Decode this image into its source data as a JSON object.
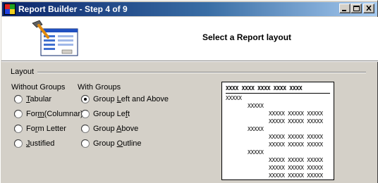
{
  "window": {
    "title": "Report Builder - Step 4 of 9"
  },
  "header": {
    "title": "Select a Report layout"
  },
  "layout_group": {
    "label": "Layout",
    "without_groups": {
      "heading": "Without Groups",
      "options": [
        {
          "label": "Tabular",
          "mnemonic": "T",
          "selected": false
        },
        {
          "label": "Form(Columnar)",
          "mnemonic": "m",
          "selected": false
        },
        {
          "label": "Form Letter",
          "mnemonic": "r",
          "selected": false
        },
        {
          "label": "Justified",
          "mnemonic": "J",
          "selected": false
        }
      ]
    },
    "with_groups": {
      "heading": "With Groups",
      "options": [
        {
          "label": "Group Left and Above",
          "mnemonic": "L",
          "selected": true
        },
        {
          "label": "Group Left",
          "mnemonic": "f",
          "selected": false
        },
        {
          "label": "Group Above",
          "mnemonic": "A",
          "selected": false
        },
        {
          "label": "Group Outline",
          "mnemonic": "O",
          "selected": false
        }
      ]
    }
  },
  "preview": {
    "header_row": "XXXX XXXX XXXX XXXX XXXX",
    "group1": "XXXXX",
    "group2": "XXXXX",
    "detail": "XXXXX XXXXX XXXXX"
  }
}
